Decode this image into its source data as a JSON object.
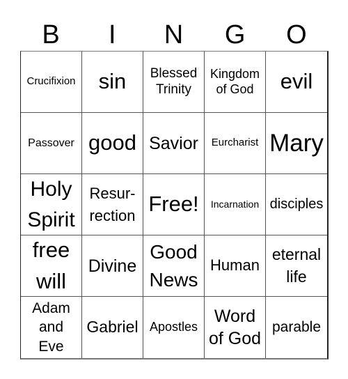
{
  "header": [
    "B",
    "I",
    "N",
    "G",
    "O"
  ],
  "cells": [
    "Crucifixion",
    "sin",
    "Blessed Trinity",
    "Kingdom of God",
    "evil",
    "Passover",
    "good",
    "Savior",
    "Eurcharist",
    "Mary",
    "Holy Spirit",
    "Resur-rection",
    "Free!",
    "Incarnation",
    "disciples",
    "free will",
    "Divine",
    "Good News",
    "Human",
    "eternal life",
    "Adam and Eve",
    "Gabriel",
    "Apostles",
    "Word of God",
    "parable"
  ]
}
